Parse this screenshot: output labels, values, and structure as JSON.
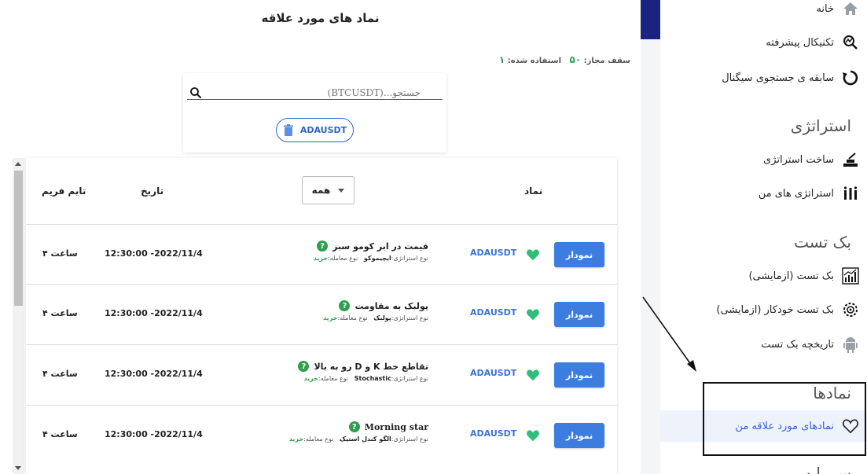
{
  "page": {
    "title": "نماد های مورد علاقه",
    "quota": {
      "limit_label": "سقف مجاز:",
      "limit_value": "۵۰",
      "used_label": "استفاده شده:",
      "used_value": "۱"
    }
  },
  "search": {
    "placeholder": "جستجو...(BTCUSDT)",
    "chip_label": "ADAUSDT"
  },
  "table": {
    "headers": {
      "symbol": "نماد",
      "date": "تاریخ",
      "timeframe": "تایم فریم"
    },
    "filter": {
      "selected": "همه"
    },
    "rows": [
      {
        "timeframe": "۴ ساعت",
        "date": "12:30:00 -2022/11/4",
        "strategy": "قیمت در ابر کومو سبز",
        "strategy_type_label": "نوع استراتژی:",
        "strategy_type": "ایچیموکو",
        "trade_type_label": "نوع معامله:",
        "trade_type": "خرید",
        "symbol": "ADAUSDT",
        "chart_label": "نمودار"
      },
      {
        "timeframe": "۴ ساعت",
        "date": "12:30:00 -2022/11/4",
        "strategy": "پولبک به مقاومت",
        "strategy_type_label": "نوع استراتژی:",
        "strategy_type": "پولبک",
        "trade_type_label": "نوع معامله:",
        "trade_type": "خرید",
        "symbol": "ADAUSDT",
        "chart_label": "نمودار"
      },
      {
        "timeframe": "۴ ساعت",
        "date": "12:30:00 -2022/11/4",
        "strategy": "تقاطع خط K و D رو به بالا",
        "strategy_type_label": "نوع استراتژی:",
        "strategy_type": "Stochastic",
        "trade_type_label": "نوع معامله:",
        "trade_type": "خرید",
        "symbol": "ADAUSDT",
        "chart_label": "نمودار"
      },
      {
        "timeframe": "۴ ساعت",
        "date": "12:30:00 -2022/11/4",
        "strategy": "Morning star",
        "strategy_type_label": "نوع استراتژی:",
        "strategy_type": "الگو کندل استیک",
        "trade_type_label": "نوع معامله:",
        "trade_type": "خرید",
        "symbol": "ADAUSDT",
        "chart_label": "نمودار"
      }
    ]
  },
  "sidebar": {
    "home": "خانه",
    "advanced_technical": "تکنیکال پیشرفته",
    "signal_history": "سابقه ی جستجوی سیگنال",
    "strategy_heading": "استراتژی",
    "build_strategy": "ساخت استراتژی",
    "my_strategies": "استراتژی های من",
    "backtest_heading": "بک تست",
    "backtest": "بک تست (ازمایشی)",
    "auto_backtest": "بک تست خودکار (ازمایشی)",
    "backtest_history": "تاریخچه بک تست",
    "symbols_heading": "نمادها",
    "favorite_symbols": "نمادهای مورد علاقه من",
    "next_heading": "سرمایه"
  },
  "colors": {
    "accent": "#1a237e",
    "primary_button": "#3d7de0",
    "buy": "#2e9e4f",
    "link": "#3b73d6"
  }
}
